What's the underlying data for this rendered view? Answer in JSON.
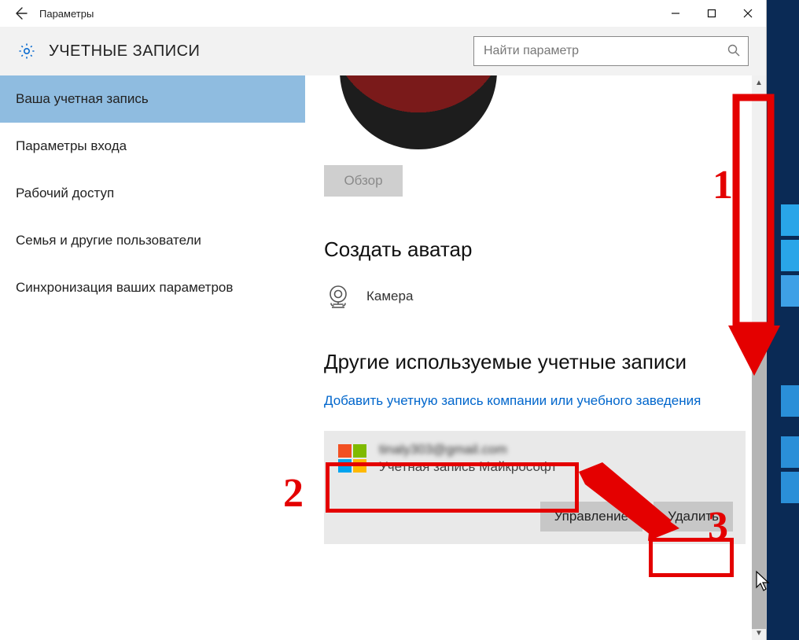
{
  "titlebar": {
    "title": "Параметры"
  },
  "header": {
    "section_title": "УЧЕТНЫЕ ЗАПИСИ",
    "search_placeholder": "Найти параметр"
  },
  "sidebar": {
    "items": [
      {
        "label": "Ваша учетная запись",
        "active": true
      },
      {
        "label": "Параметры входа",
        "active": false
      },
      {
        "label": "Рабочий доступ",
        "active": false
      },
      {
        "label": "Семья и другие пользователи",
        "active": false
      },
      {
        "label": "Синхронизация ваших параметров",
        "active": false
      }
    ]
  },
  "content": {
    "overview_button": "Обзор",
    "create_avatar_heading": "Создать аватар",
    "camera_label": "Камера",
    "other_accounts_heading": "Другие используемые учетные записи",
    "add_account_link": "Добавить учетную запись компании или учебного заведения",
    "account": {
      "email": "tinaly303@gmail.com",
      "type": "Учетная запись Майкрософт"
    },
    "manage_button": "Управление",
    "delete_button": "Удалить"
  },
  "annotations": {
    "n1": "1",
    "n2": "2",
    "n3": "3"
  }
}
